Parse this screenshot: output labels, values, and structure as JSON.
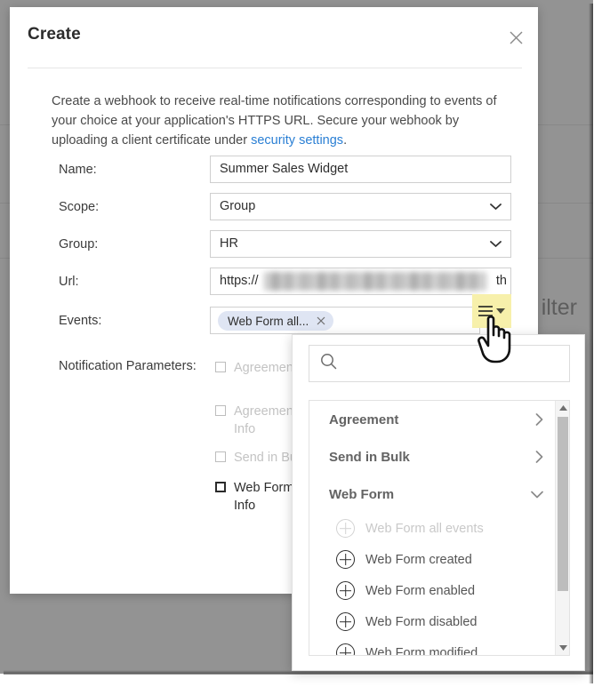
{
  "background": {
    "partial_text": "ilter",
    "overlay_color": "#939393"
  },
  "dialog": {
    "title": "Create",
    "close_icon": "close-icon",
    "intro": {
      "text_before_link": "Create a webhook to receive real-time notifications corresponding to events of your choice at your application's HTTPS URL. Secure your webhook by uploading a client certificate under ",
      "link_text": "security settings",
      "text_after_link": "."
    },
    "fields": [
      {
        "label": "Name:",
        "type": "text",
        "value": "Summer Sales Widget"
      },
      {
        "label": "Scope:",
        "type": "select",
        "value": "Group"
      },
      {
        "label": "Group:",
        "type": "select",
        "value": "HR"
      },
      {
        "label": "Url:",
        "type": "text",
        "value_prefix": "https://",
        "value_suffix": "th",
        "redacted": true
      }
    ],
    "events": {
      "label": "Events:",
      "chips": [
        {
          "label": "Web Form all...",
          "remove_icon": "close-icon"
        }
      ],
      "menu_button": {
        "icon": "hamburger-menu-icon",
        "caret": "caret-down-icon",
        "highlight_color": "#f7f0ab"
      }
    },
    "notification_parameters": {
      "label": "Notification Parameters:",
      "items": [
        {
          "label": "Agreement Inf",
          "checked": false,
          "disabled": true
        },
        {
          "label": "Agreement Pa Info",
          "checked": false,
          "disabled": true
        },
        {
          "label": "Send in Bulk I",
          "checked": false,
          "disabled": true
        },
        {
          "label": "Web Form Do Info",
          "checked": false,
          "disabled": false
        }
      ]
    }
  },
  "dropdown": {
    "search": {
      "placeholder": "",
      "value": "",
      "icon": "search-icon"
    },
    "groups": [
      {
        "label": "Agreement",
        "expanded": false,
        "arrow": "chevron-right-icon"
      },
      {
        "label": "Send in Bulk",
        "expanded": false,
        "arrow": "chevron-right-icon"
      },
      {
        "label": "Web Form",
        "expanded": true,
        "arrow": "chevron-down-icon"
      }
    ],
    "options": [
      {
        "label": "Web Form all events",
        "icon": "plus-circle-icon",
        "dimmed": true
      },
      {
        "label": "Web Form created",
        "icon": "plus-circle-icon",
        "dimmed": false
      },
      {
        "label": "Web Form enabled",
        "icon": "plus-circle-icon",
        "dimmed": false
      },
      {
        "label": "Web Form disabled",
        "icon": "plus-circle-icon",
        "dimmed": false
      },
      {
        "label": "Web Form modified",
        "icon": "plus-circle-icon",
        "dimmed": false
      }
    ],
    "scrollbar": {
      "up_icon": "triangle-up-icon",
      "down_icon": "triangle-down-icon"
    }
  }
}
